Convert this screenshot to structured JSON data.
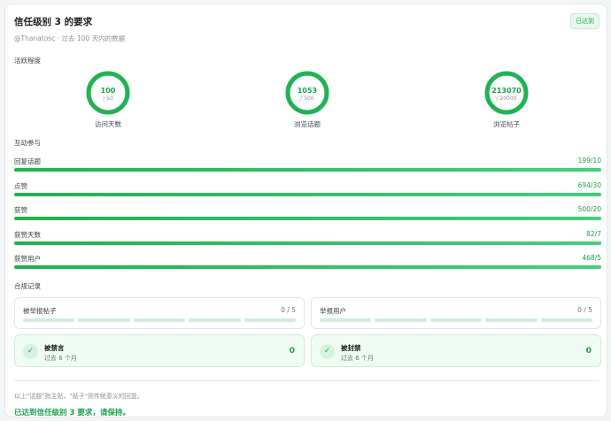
{
  "header": {
    "title": "信任级别 3 的要求",
    "badge": "已达到",
    "subtitle": "@Thanatosc · 过去 100 天内的数据"
  },
  "activity": {
    "label": "活跃程度",
    "rings": [
      {
        "value": "100",
        "target": "/ 50",
        "caption": "访问天数",
        "progress": 1.0
      },
      {
        "value": "1053",
        "target": "/ 500",
        "caption": "浏览话题",
        "progress": 1.0
      },
      {
        "value": "213070",
        "target": "/ 20000",
        "caption": "浏览帖子",
        "progress": 1.0
      }
    ]
  },
  "interaction": {
    "label": "互动参与",
    "bars": [
      {
        "label": "回复话题",
        "value": "199/10",
        "progress": 1.0
      },
      {
        "label": "点赞",
        "value": "694/30",
        "progress": 1.0
      },
      {
        "label": "获赞",
        "value": "500/20",
        "progress": 1.0
      },
      {
        "label": "获赞天数",
        "value": "82/7",
        "progress": 1.0
      },
      {
        "label": "获赞用户",
        "value": "468/5",
        "progress": 1.0
      }
    ]
  },
  "compliance": {
    "label": "合规记录",
    "reports": [
      {
        "label": "被举报帖子",
        "count": "0 / 5"
      },
      {
        "label": "举报用户",
        "count": "0 / 5"
      }
    ],
    "statuses": [
      {
        "title": "被禁言",
        "sub": "过去 6 个月",
        "count": "0"
      },
      {
        "title": "被封禁",
        "sub": "过去 6 个月",
        "count": "0"
      }
    ]
  },
  "footer": {
    "note": "以上\"话题\"指主贴，\"帖子\"则传统意义的回复。",
    "result": "已达到信任级别 3 要求，请保持。"
  },
  "colors": {
    "accent": "#1ca24a",
    "ring_track": "#dff3e6"
  },
  "icons": {
    "status_check": "check-icon"
  }
}
